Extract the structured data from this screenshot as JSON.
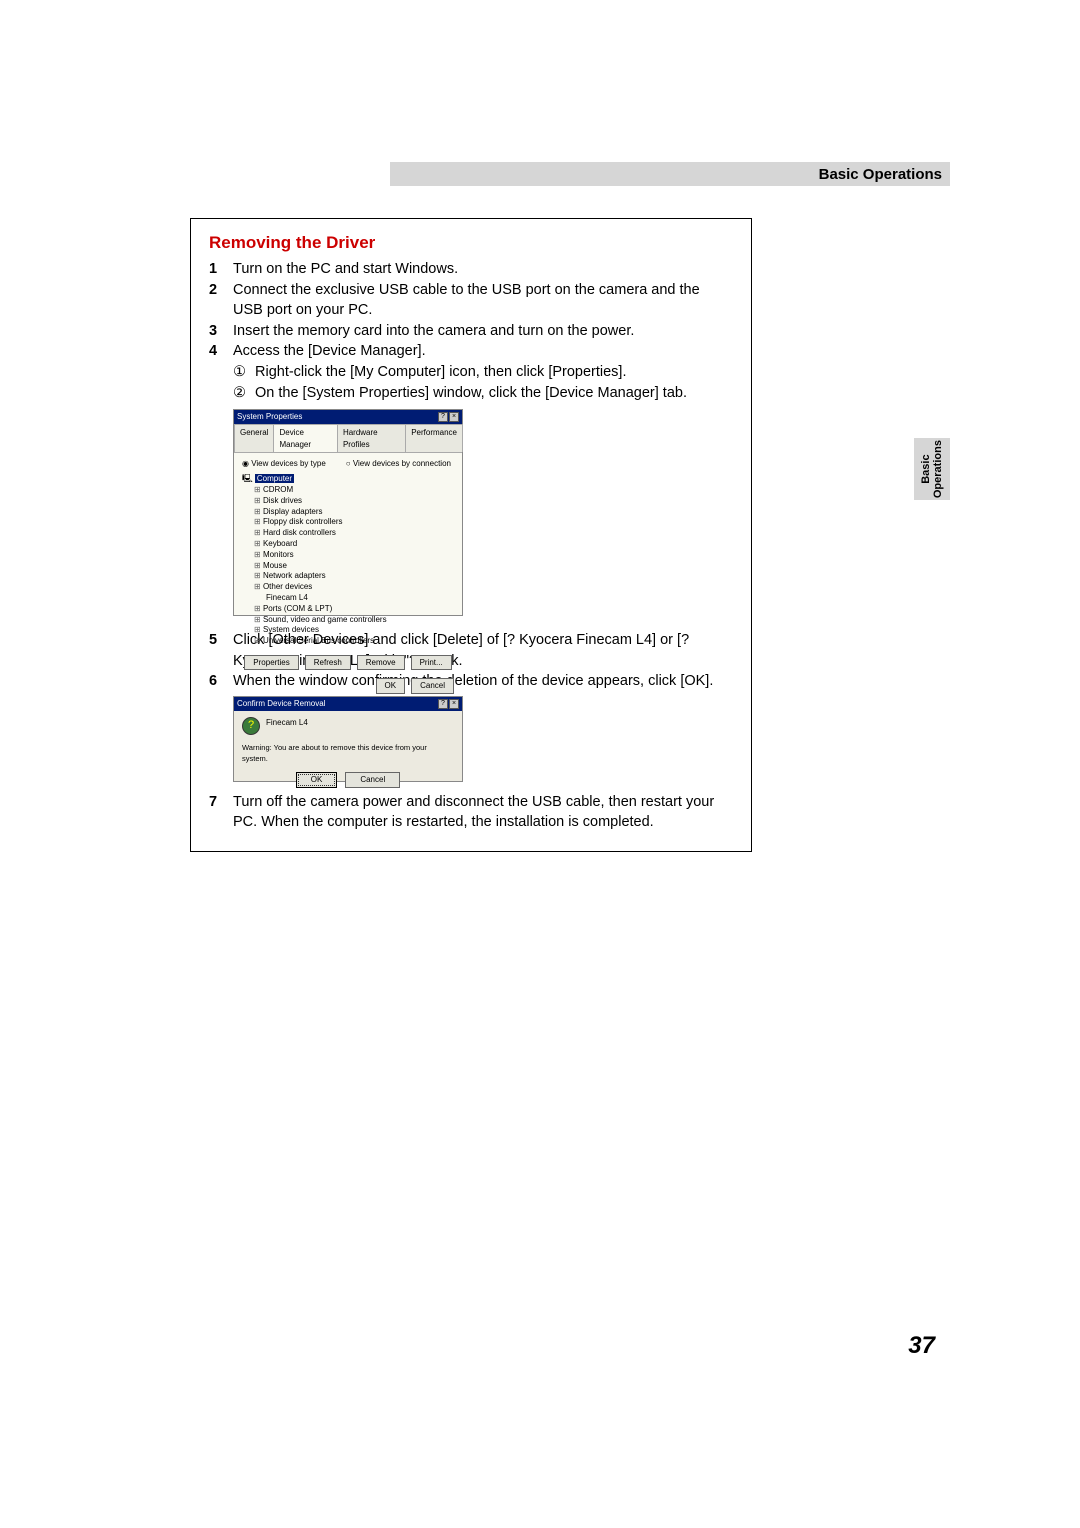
{
  "header": {
    "title": "Basic Operations"
  },
  "sideTab": {
    "line1": "Basic",
    "line2": "Operations"
  },
  "pageNumber": "37",
  "content": {
    "heading": "Removing the Driver",
    "steps": [
      {
        "num": "1",
        "text": "Turn on the PC and start Windows."
      },
      {
        "num": "2",
        "text": "Connect the exclusive USB cable to the USB port on the camera and the USB port on your PC."
      },
      {
        "num": "3",
        "text": "Insert the memory card into the camera and turn on the power."
      },
      {
        "num": "4",
        "text": "Access the [Device Manager]."
      }
    ],
    "substeps4": [
      {
        "circ": "①",
        "text": "Right-click the [My Computer] icon, then click [Properties]."
      },
      {
        "circ": "②",
        "text": "On the [System Properties] window, click the [Device Manager] tab."
      }
    ],
    "steps2": [
      {
        "num": "5",
        "text": "Click [Other Devices] and click [Delete] of [? Kyocera Finecam L4] or [? Kyocera Finecam L3] with \"?\" mark."
      },
      {
        "num": "6",
        "text": "When the window confirming the deletion of the device appears, click [OK]."
      }
    ],
    "steps3": [
      {
        "num": "7",
        "text": "Turn off the camera power and disconnect the USB cable, then restart your PC. When the computer is restarted, the installation is completed."
      }
    ]
  },
  "win1": {
    "title": "System Properties",
    "help": "?",
    "close": "×",
    "tabs": {
      "general": "General",
      "devmgr": "Device Manager",
      "hw": "Hardware Profiles",
      "perf": "Performance"
    },
    "radio1": "View devices by type",
    "radio2": "View devices by connection",
    "tree": {
      "root": "Computer",
      "items": [
        "CDROM",
        "Disk drives",
        "Display adapters",
        "Floppy disk controllers",
        "Hard disk controllers",
        "Keyboard",
        "Monitors",
        "Mouse",
        "Network adapters",
        "Other devices"
      ],
      "child": "Finecam L4",
      "items2": [
        "Ports (COM & LPT)",
        "Sound, video and game controllers",
        "System devices",
        "Universal Serial Bus controllers"
      ]
    },
    "buttons": {
      "props": "Properties",
      "refresh": "Refresh",
      "remove": "Remove",
      "print": "Print..."
    },
    "ok": "OK",
    "cancel": "Cancel"
  },
  "win2": {
    "title": "Confirm Device Removal",
    "help": "?",
    "close": "×",
    "device": "Finecam L4",
    "warning": "Warning: You are about to remove this device from your system.",
    "ok": "OK",
    "cancel": "Cancel"
  }
}
